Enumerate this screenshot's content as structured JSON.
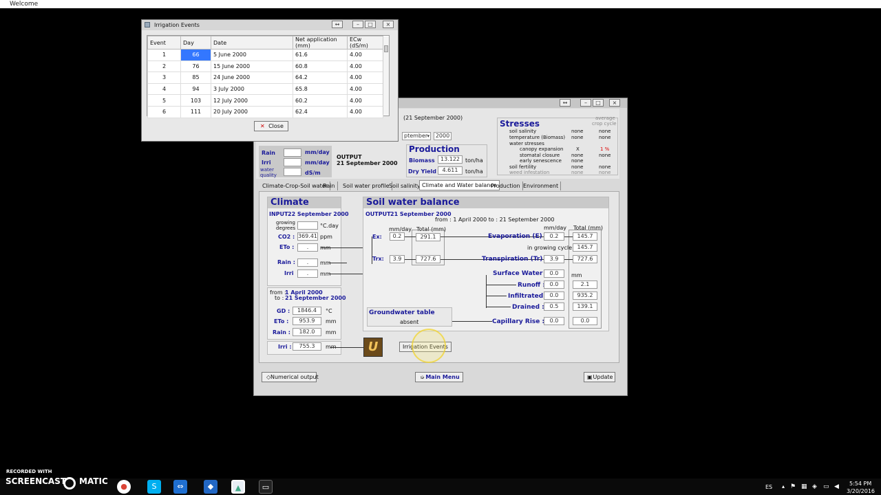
{
  "window_title": "Welcome",
  "irrigation": {
    "title": "Irrigation Events",
    "headers": [
      "Event",
      "Day",
      "Date",
      "Net application (mm)",
      "ECw (dS/m)"
    ],
    "rows": [
      [
        "1",
        "66",
        "5 June 2000",
        "61.6",
        "4.00"
      ],
      [
        "2",
        "76",
        "15 June 2000",
        "60.8",
        "4.00"
      ],
      [
        "3",
        "85",
        "24 June 2000",
        "64.2",
        "4.00"
      ],
      [
        "4",
        "94",
        "3 July 2000",
        "65.8",
        "4.00"
      ],
      [
        "5",
        "103",
        "12 July 2000",
        "60.2",
        "4.00"
      ],
      [
        "6",
        "111",
        "20 July 2000",
        "62.4",
        "4.00"
      ]
    ],
    "close_label": "Close"
  },
  "main": {
    "date_top": "(21 September 2000)",
    "month_select": "ptember",
    "year": "2000",
    "rain_label": "Rain",
    "irri_label": "Irri",
    "water_quality_label": "water quality",
    "mmday1": "mm/day",
    "mmday2": "mm/day",
    "dsm": "dS/m",
    "output_label": "OUTPUT",
    "output_date": "21 September 2000",
    "production": {
      "title": "Production",
      "biomass_label": "Biomass",
      "biomass": "13.122",
      "biomass_unit": "ton/ha",
      "dry_yield_label": "Dry Yield",
      "dry_yield": "4.611",
      "dry_yield_unit": "ton/ha"
    },
    "stresses": {
      "title": "Stresses",
      "avg1": "average",
      "avg2": "crop cycle",
      "soil_salinity": "soil salinity",
      "temperature": "temperature (Biomass)",
      "water_stresses": "water stresses",
      "canopy": "canopy expansion",
      "stomatal": "stomatal closure",
      "senescence": "early senescence",
      "soil_fertility": "soil fertility",
      "weed": "weed infestation",
      "none": "none",
      "x": "X",
      "pct": "1 %"
    },
    "tabs": [
      "Climate-Crop-Soil water",
      "Rain",
      "Soil water profile",
      "Soil salinity",
      "Climate and Water balance",
      "Production",
      "Environment"
    ],
    "climate": {
      "title": "Climate",
      "input_label": "INPUT",
      "input_date": "22 September 2000",
      "growing_degrees": "growing degrees",
      "cday": "°C.day",
      "co2_label": "CO2 :",
      "co2": "369.41",
      "ppm": "ppm",
      "eto_label": "ETo :",
      "eto": ".",
      "rain_label": "Rain :",
      "rain": ".",
      "irri_label": "Irri",
      "irri": ".",
      "mm": "mm",
      "from_label": "from :",
      "from_date": "1 April 2000",
      "to_label": "to :",
      "to_date": "21 September 2000",
      "gd_label": "GD :",
      "gd": "1846.4",
      "gd_unit": "°C",
      "eto2_label": "ETo :",
      "eto2": "953.9",
      "rain2_label": "Rain :",
      "rain2": "182.0",
      "irri2_label": "Irri :",
      "irri2": "755.3"
    },
    "swb": {
      "title": "Soil water balance",
      "output_label": "OUTPUT",
      "output_date": "21 September 2000",
      "period": "from : 1 April 2000  to : 21 September 2000",
      "mmday": "mm/day",
      "total": "Total (mm)",
      "ex_label": "Ex:",
      "ex": "0.2",
      "ex_total": "291.1",
      "trx_label": "Trx:",
      "trx": "3.9",
      "trx_total": "727.6",
      "evap_label": "Evaporation (E) :",
      "evap": "0.2",
      "evap_total": "145.7",
      "in_cycle": "in growing cycle",
      "in_cycle_total": "145.7",
      "transp_label": "Transpiration (Tr) :",
      "transp": "3.9",
      "transp_total": "727.6",
      "surface_label": "Surface Water :",
      "surface": "0.0",
      "surface_unit": "mm",
      "runoff_label": "Runoff :",
      "runoff": "0.0",
      "runoff_total": "2.1",
      "infil_label": "Infiltrated :",
      "infil": "0.0",
      "infil_total": "935.2",
      "drained_label": "Drained :",
      "drained": "0.5",
      "drained_total": "139.1",
      "gw_title": "Groundwater table",
      "gw_value": "absent",
      "cap_label": "Capillary Rise :",
      "cap": "0.0",
      "cap_total": "0.0"
    },
    "irr_button": "Irrigation Events",
    "numerical_output": "Numerical output",
    "main_menu": "Main Menu",
    "update": "Update"
  },
  "overlay": {
    "recorded_with": "RECORDED WITH",
    "brand_a": "SCREENCAST",
    "brand_b": "MATIC"
  },
  "taskbar": {
    "lang": "ES",
    "time": "5:54 PM",
    "date": "3/20/2016"
  }
}
